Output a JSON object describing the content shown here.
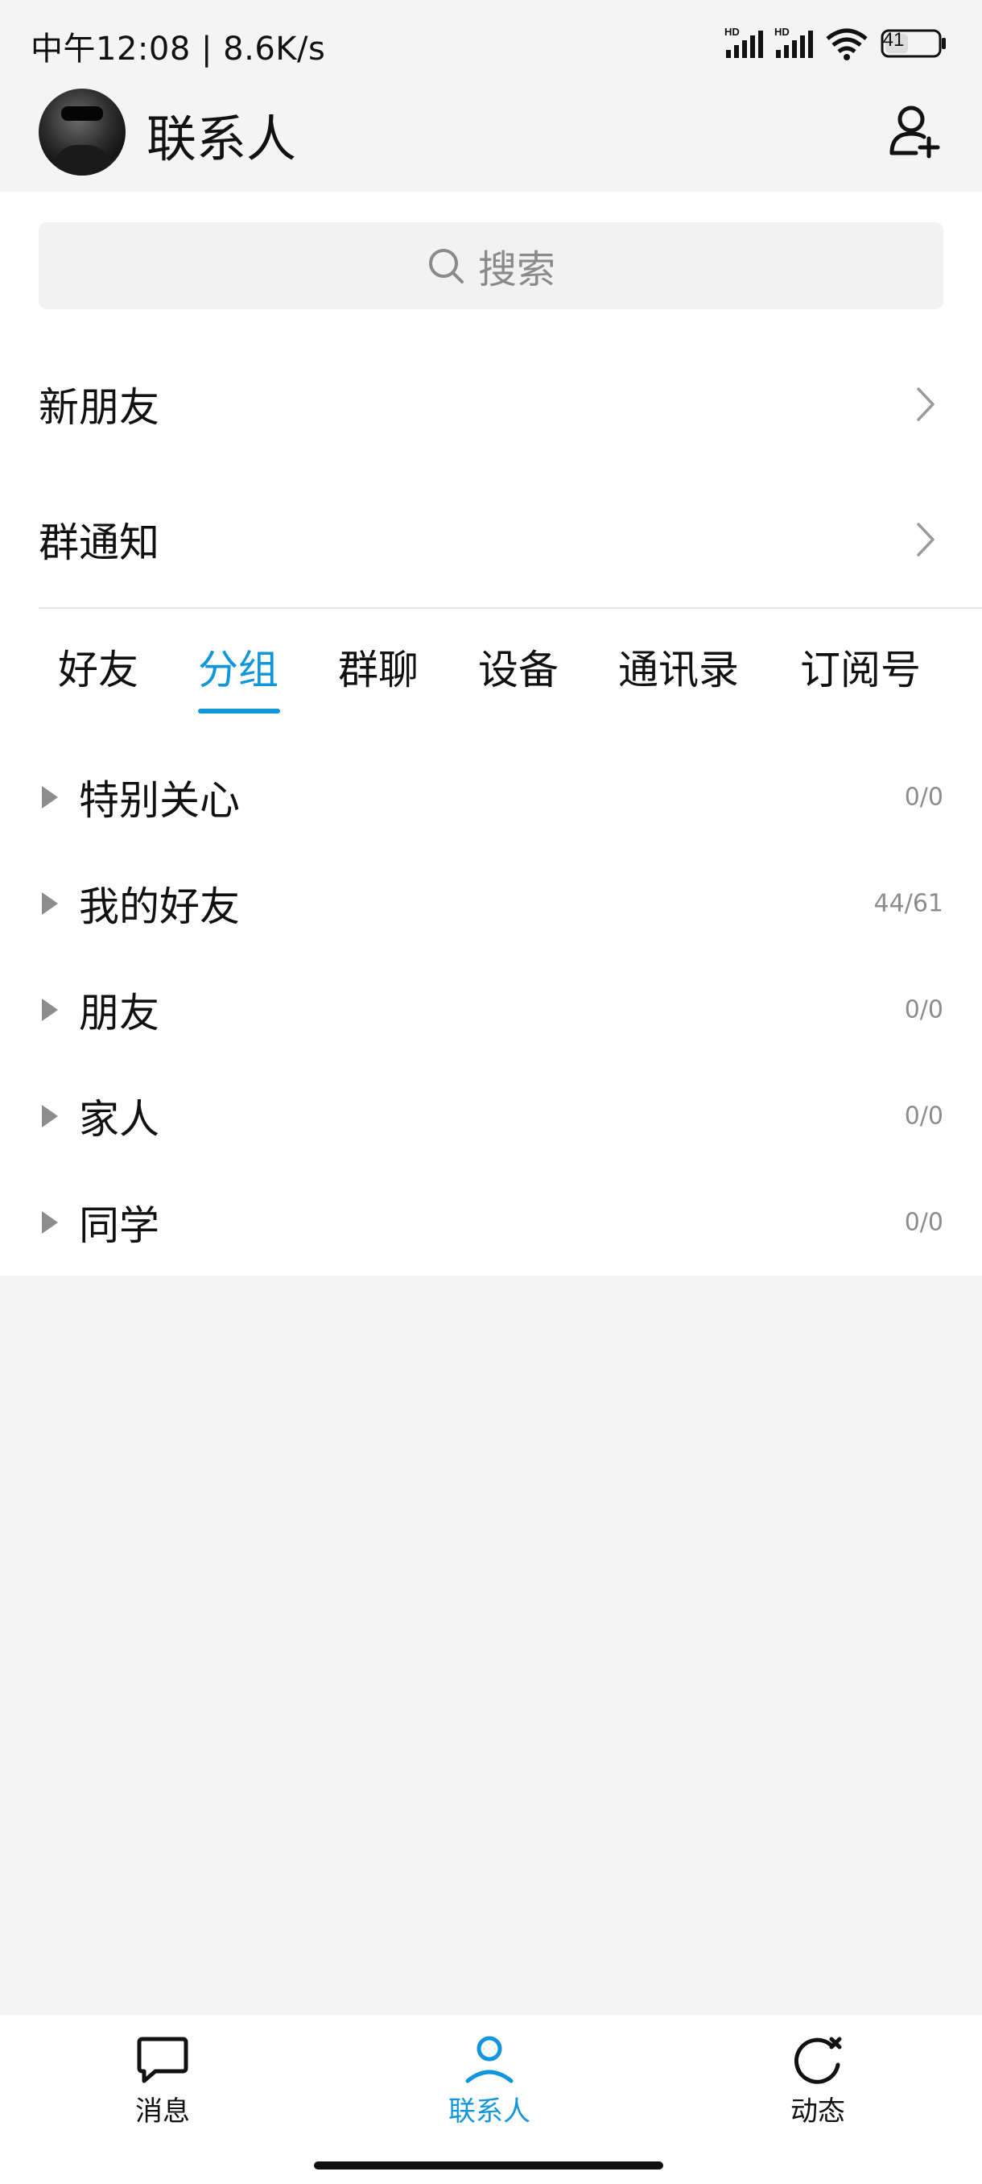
{
  "status_bar": {
    "left_text": "中午12:08 | 8.6K/s",
    "battery": "41"
  },
  "header": {
    "title": "联系人",
    "avatar_icon": "user-avatar",
    "add_icon": "add-contact-icon"
  },
  "search": {
    "placeholder": "搜索",
    "icon": "search-icon"
  },
  "rows": [
    {
      "label": "新朋友"
    },
    {
      "label": "群通知"
    }
  ],
  "tabs": [
    {
      "label": "好友",
      "active": false
    },
    {
      "label": "分组",
      "active": true
    },
    {
      "label": "群聊",
      "active": false
    },
    {
      "label": "设备",
      "active": false
    },
    {
      "label": "通讯录",
      "active": false
    },
    {
      "label": "订阅号",
      "active": false
    }
  ],
  "groups": [
    {
      "name": "特别关心",
      "count": "0/0"
    },
    {
      "name": "我的好友",
      "count": "44/61"
    },
    {
      "name": "朋友",
      "count": "0/0"
    },
    {
      "name": "家人",
      "count": "0/0"
    },
    {
      "name": "同学",
      "count": "0/0"
    }
  ],
  "bottom_nav": [
    {
      "label": "消息",
      "icon": "message-icon",
      "active": false
    },
    {
      "label": "联系人",
      "icon": "contacts-icon",
      "active": true
    },
    {
      "label": "动态",
      "icon": "moments-icon",
      "active": false
    }
  ],
  "colors": {
    "accent": "#1296db",
    "background": "#f4f4f4",
    "panel": "#ffffff"
  }
}
